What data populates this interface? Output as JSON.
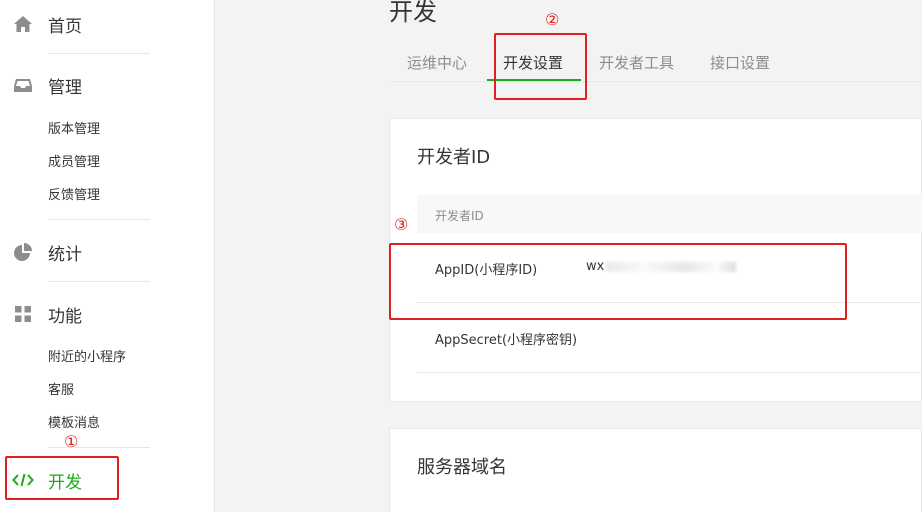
{
  "sidebar": {
    "home_label": "首页",
    "manage_label": "管理",
    "manage_items": [
      "版本管理",
      "成员管理",
      "反馈管理"
    ],
    "stats_label": "统计",
    "feature_label": "功能",
    "feature_items": [
      "附近的小程序",
      "客服",
      "模板消息"
    ],
    "dev_label": "开发"
  },
  "main": {
    "page_title": "开发",
    "tabs": [
      "运维中心",
      "开发设置",
      "开发者工具",
      "接口设置"
    ],
    "active_tab": 1,
    "dev_id_card": {
      "title": "开发者ID",
      "header": "开发者ID",
      "rows": [
        {
          "key": "AppID(小程序ID)",
          "value_prefix": "wx"
        },
        {
          "key": "AppSecret(小程序密钥)",
          "value_prefix": ""
        }
      ]
    },
    "server_card": {
      "title": "服务器域名"
    }
  },
  "annotations": {
    "one": "①",
    "two": "②",
    "three": "③"
  },
  "colors": {
    "accent": "#1aad19",
    "annotation": "#e02020",
    "text": "#353535",
    "muted": "#8d8d8d"
  },
  "icons": {
    "home": "home-icon",
    "manage": "inbox-icon",
    "stats": "pie-chart-icon",
    "feature": "grid-icon",
    "dev": "code-icon"
  }
}
